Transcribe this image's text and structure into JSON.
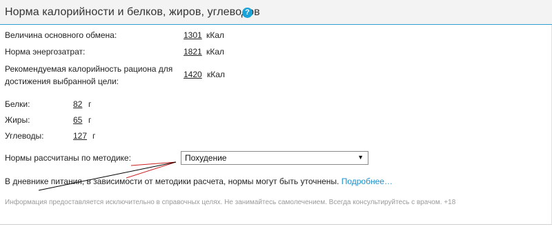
{
  "header": {
    "title": "Норма калорийности и белков, жиров, углеводов",
    "help_icon": "question-circle-icon",
    "help_glyph": "?"
  },
  "energy": [
    {
      "label": "Величина основного обмена:",
      "value": "1301",
      "unit": "кКал"
    },
    {
      "label": "Норма энергозатрат:",
      "value": "1821",
      "unit": "кКал"
    },
    {
      "label_line1": "Рекомендуемая калорийность рациона для",
      "label_line2": "достижения выбранной цели:",
      "value": "1420",
      "unit": "кКал"
    }
  ],
  "macros": [
    {
      "label": "Белки:",
      "value": "82",
      "unit": "г"
    },
    {
      "label": "Жиры:",
      "value": "65",
      "unit": "г"
    },
    {
      "label": "Углеводы:",
      "value": "127",
      "unit": "г"
    }
  ],
  "method": {
    "label": "Нормы рассчитаны по методике:",
    "selected": "Похудение",
    "arrow_icon": "triangle-down-icon",
    "arrow_glyph": "▼"
  },
  "note": {
    "text": "В дневнике питания, в зависимости от методики расчета, нормы могут быть уточнены.",
    "link": "Подробнее…"
  },
  "disclaimer": "Информация предоставляется исключительно в справочных целях. Не занимайтесь самолечением. Всегда консультируйтесь с врачом. +18",
  "colors": {
    "accent": "#1aa3d8",
    "link": "#1a8fc9",
    "header_line": "#2e9fd1",
    "annotation_red": "#cc1f1f",
    "annotation_black": "#000000"
  }
}
